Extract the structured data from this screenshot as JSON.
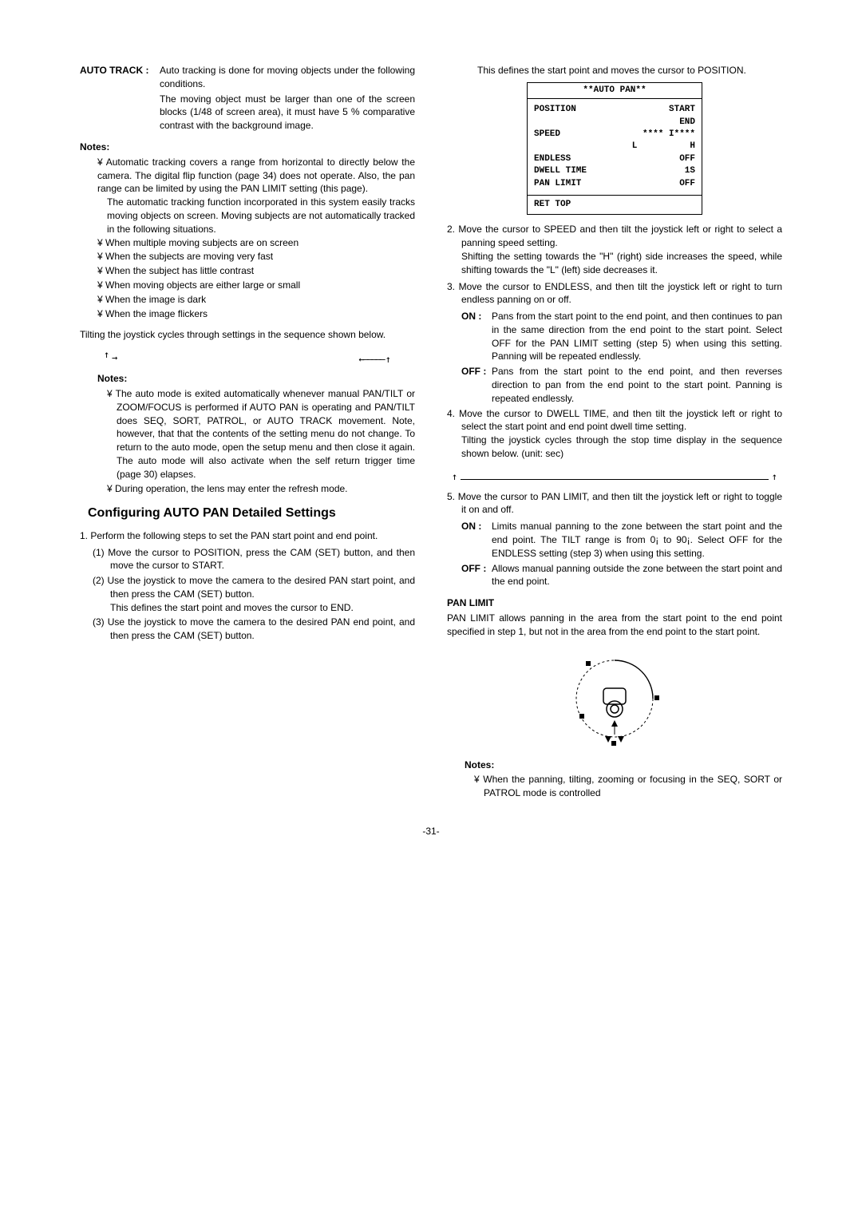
{
  "left": {
    "auto_track_label": "AUTO TRACK :",
    "auto_track_desc1": "Auto tracking is done for moving objects under the following conditions.",
    "auto_track_desc2": "The moving object must be larger than one of the screen blocks (1/48 of screen area), it must have 5 % comparative contrast with the background image.",
    "notes_label": "Notes:",
    "note1_p1": "Automatic tracking covers a range from horizontal to directly below the camera. The digital flip function (page 34) does not operate. Also, the pan range can be limited by using the PAN LIMIT setting (this page).",
    "note1_p2": "The automatic tracking function incorporated in this system easily tracks moving objects on screen. Moving subjects are not automatically tracked in the following situations.",
    "b1": "¥  When multiple moving subjects are on screen",
    "b2": "¥  When the subjects are moving very fast",
    "b3": "¥  When the subject has little contrast",
    "b4": "¥  When moving objects are either large or small",
    "b5": "¥  When the image is dark",
    "b6": "¥  When the image flickers",
    "tilt_para": "Tilting the joystick cycles through settings in the sequence shown below.",
    "notes2_label": "Notes:",
    "note2_b1": "¥  The auto mode is exited automatically whenever manual PAN/TILT or ZOOM/FOCUS is performed if AUTO PAN is operating and PAN/TILT does SEQ, SORT, PATROL, or AUTO TRACK movement. Note, however, that that the contents of the setting menu do not change. To return to the auto mode, open the setup menu and then close it again. The auto mode will also activate when the self return trigger time (page 30) elapses.",
    "note2_b2": "¥  During operation, the lens may enter the refresh mode.",
    "heading": "Configuring AUTO PAN Detailed Settings",
    "s1": "1. Perform the following steps to set the PAN start point and end point.",
    "s1_1": "(1) Move the cursor to POSITION, press the CAM (SET) button, and then move the cursor to START.",
    "s1_2": "(2) Use the joystick to move the camera to the desired PAN start point, and then press the CAM (SET) button.",
    "s1_2b": "This defines the start point and moves the cursor to END.",
    "s1_3": "(3) Use the joystick to move the camera to the desired PAN end point, and then press the CAM (SET) button."
  },
  "right": {
    "top_para": "This defines the start point and moves the cursor to POSITION.",
    "menu_title": "**AUTO PAN**",
    "m_position": "POSITION",
    "m_position_v": "START",
    "m_end": "END",
    "m_speed": "SPEED",
    "m_speed_v": "**** I****",
    "m_lh": "L          H",
    "m_endless": "ENDLESS",
    "m_endless_v": "OFF",
    "m_dwell": "DWELL TIME",
    "m_dwell_v": "1S",
    "m_panlimit": "PAN LIMIT",
    "m_panlimit_v": "OFF",
    "m_ret": "RET TOP",
    "s2": "2. Move the cursor to SPEED and then tilt the joystick left or right to select a panning speed setting.",
    "s2b": "Shifting the setting towards the \"H\" (right) side increases the speed, while shifting towards the \"L\" (left) side decreases it.",
    "s3": "3. Move the cursor to ENDLESS, and then tilt the joystick left or right to turn endless panning on or off.",
    "s3_on_label": "ON   :",
    "s3_on": "Pans from the start point to the end point, and then continues to pan in the same direction from the end point to the start point. Select OFF for the PAN LIMIT setting (step 5) when using this setting. Panning will be repeated endlessly.",
    "s3_off_label": "OFF :",
    "s3_off": "Pans from the start point to the end point, and then reverses direction to pan from the end point to the start point. Panning is repeated endlessly.",
    "s4": "4. Move the cursor to DWELL TIME, and then tilt the joystick left or right to select the start point and end point dwell time setting.",
    "s4b": "Tilting the joystick cycles through the stop time display in the sequence shown below. (unit: sec)",
    "s5": "5. Move the cursor to PAN LIMIT, and then tilt the joystick left or right to toggle it on and off.",
    "s5_on_label": "ON   :",
    "s5_on": "Limits manual panning to the zone between the start point and the end point.  The TILT range is from 0¡ to 90¡. Select OFF for the ENDLESS setting (step 3) when using this setting.",
    "s5_off_label": "OFF :",
    "s5_off": "Allows manual panning outside the zone between the start point and the end point.",
    "panlimit_h": "PAN LIMIT",
    "panlimit_p": "PAN LIMIT allows panning in the area from the start point to the end point specified in step 1, but not in the area from the end point to the start point.",
    "notes3_label": "Notes:",
    "note3_b1": "¥  When the panning, tilting, zooming or focusing in the SEQ, SORT or PATROL mode is controlled"
  },
  "page_num": "-31-"
}
